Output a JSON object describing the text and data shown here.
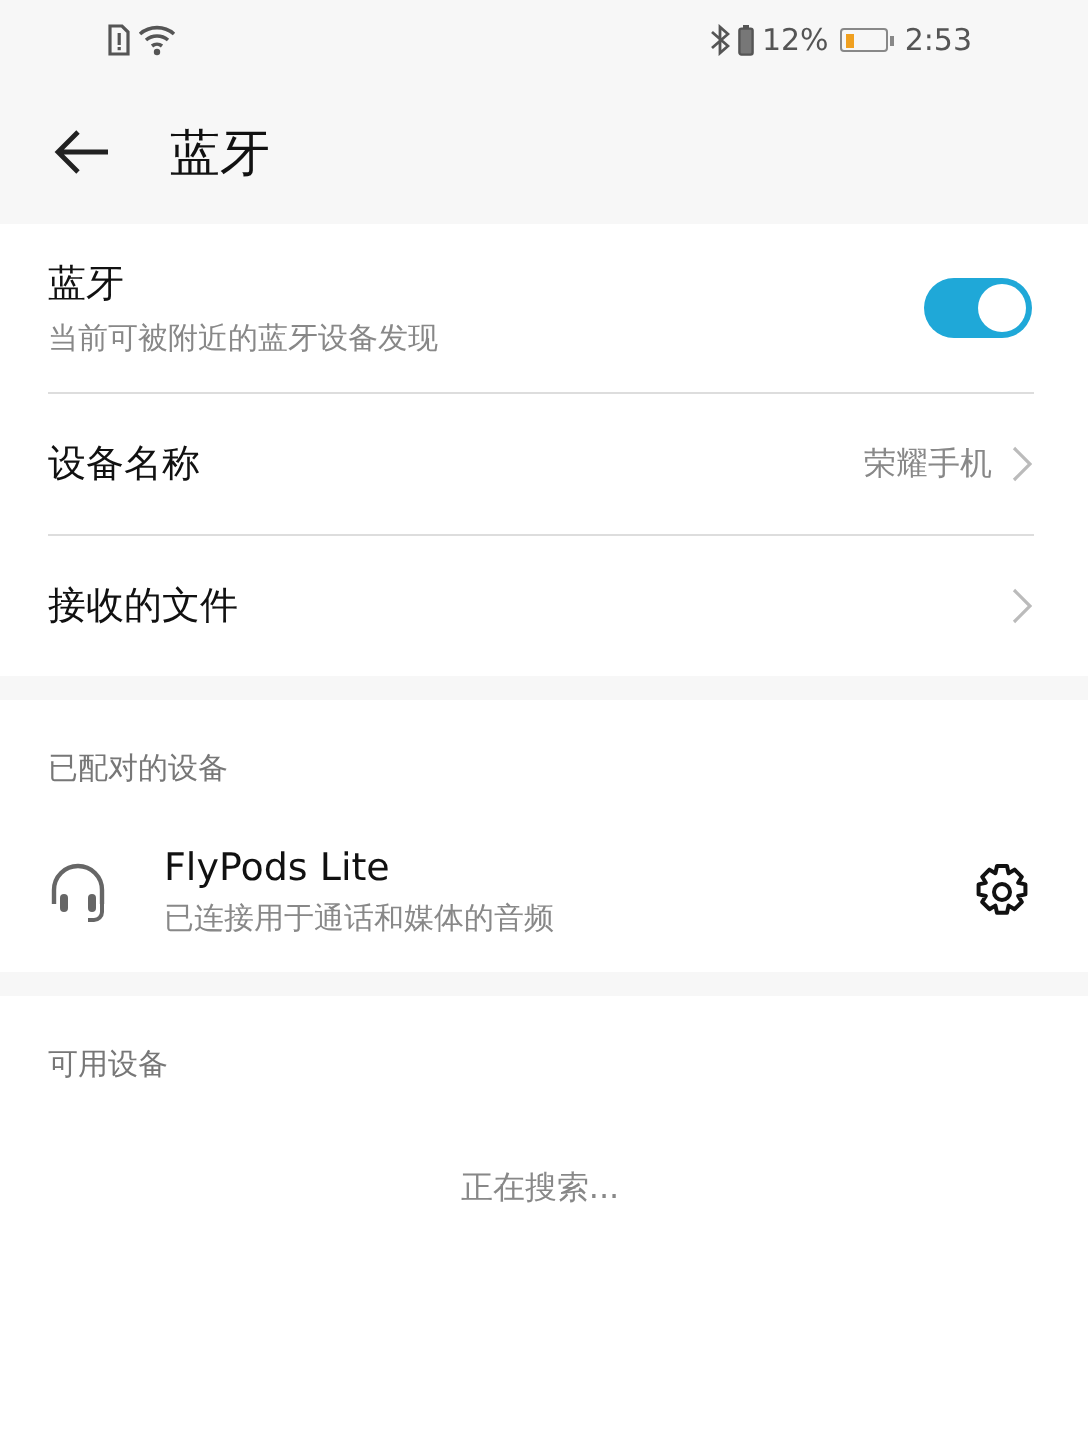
{
  "status_bar": {
    "battery_text": "12%",
    "time": "2:53"
  },
  "header": {
    "title": "蓝牙"
  },
  "settings": [
    {
      "kind": "toggle",
      "label": "蓝牙",
      "description": "当前可被附近的蓝牙设备发现",
      "on": true
    },
    {
      "kind": "link",
      "label": "设备名称",
      "value": "荣耀手机"
    },
    {
      "kind": "link",
      "label": "接收的文件"
    }
  ],
  "paired": {
    "heading": "已配对的设备",
    "devices": [
      {
        "name": "FlyPods Lite",
        "status": "已连接用于通话和媒体的音频"
      }
    ]
  },
  "available": {
    "heading": "可用设备",
    "status": "正在搜索..."
  }
}
